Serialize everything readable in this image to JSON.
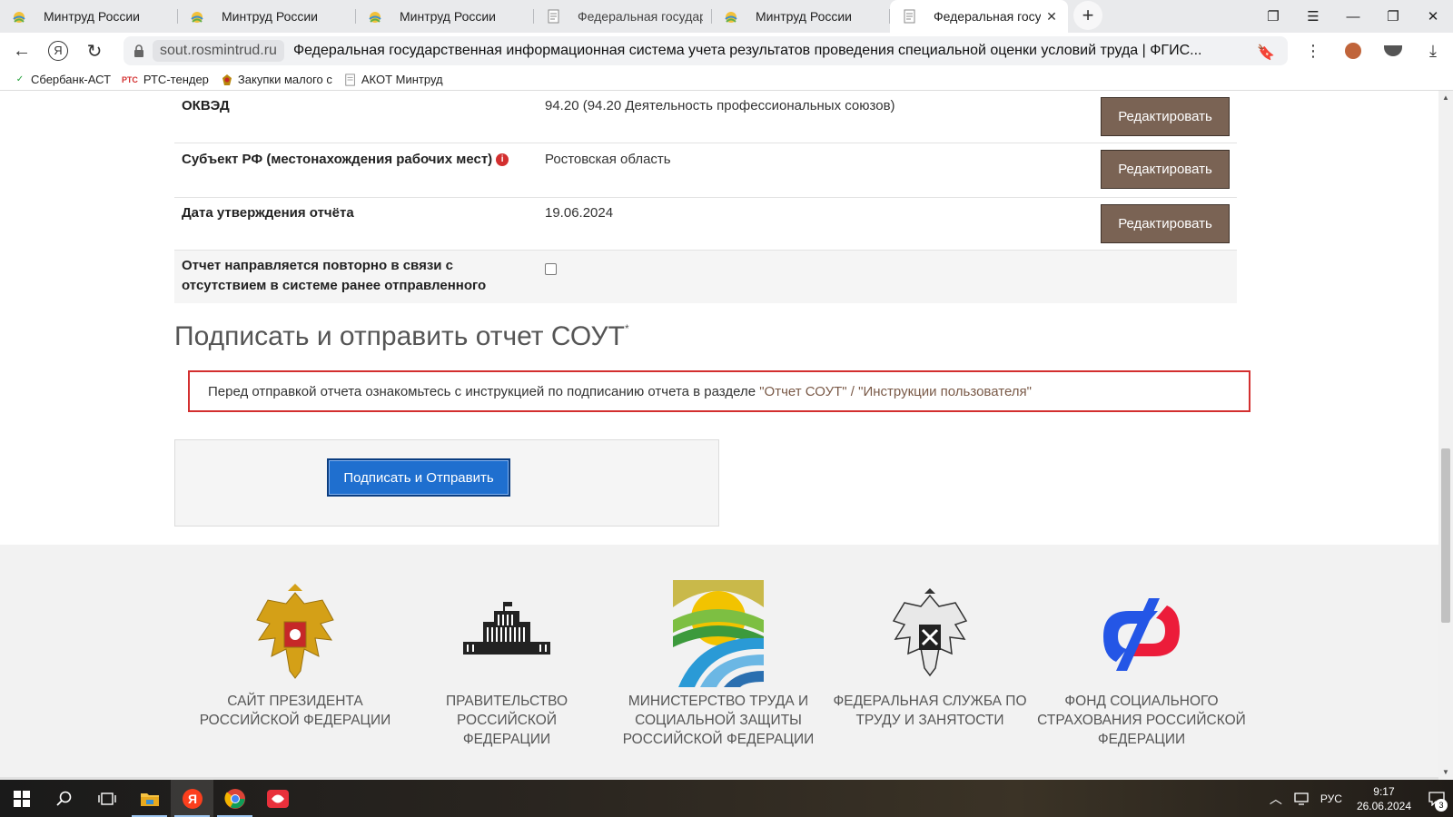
{
  "browser": {
    "tabs": [
      {
        "label": "Минтруд России",
        "favicon": "mintrud-favicon",
        "active": false
      },
      {
        "label": "Минтруд России",
        "favicon": "mintrud-favicon",
        "active": false
      },
      {
        "label": "Минтруд России",
        "favicon": "mintrud-favicon",
        "active": false
      },
      {
        "label": "Федеральная государстве",
        "favicon": "document-favicon",
        "active": false
      },
      {
        "label": "Минтруд России",
        "favicon": "mintrud-favicon",
        "active": false
      },
      {
        "label": "Федеральная государс",
        "favicon": "document-favicon",
        "active": true
      }
    ],
    "new_tab_symbol": "+",
    "address": {
      "domain": "sout.rosmintrud.ru",
      "title": "Федеральная государственная информационная система учета результатов проведения специальной оценки условий труда | ФГИС..."
    },
    "bookmarks": [
      {
        "label": "Сбербанк-АСТ",
        "icon": "sberbank-icon"
      },
      {
        "label": "РТС-тендер",
        "icon": "rts-icon",
        "prefix": "РТС"
      },
      {
        "label": "Закупки малого с",
        "icon": "emblem-icon"
      },
      {
        "label": "АКОТ Минтруд",
        "icon": "document-icon"
      }
    ]
  },
  "report": {
    "rows": [
      {
        "label": "ОКВЭД",
        "value": "94.20 (94.20 Деятельность профессиональных союзов)",
        "button": "Редактировать"
      },
      {
        "label": "Субъект РФ (местонахождения рабочих мест)",
        "value": "Ростовская область",
        "button": "Редактировать",
        "info": "i"
      },
      {
        "label": "Дата утверждения отчёта",
        "value": "19.06.2024",
        "button": "Редактировать"
      },
      {
        "label_line1": "Отчет направляется повторно в связи с",
        "label_line2": "отсутствием в системе ранее отправленного",
        "checked": false
      }
    ],
    "section_title": "Подписать и отправить отчет СОУТ",
    "section_title_mark": "*",
    "notice": {
      "text": "Перед отправкой отчета ознакомьтесь с инструкцией по подписанию отчета в разделе ",
      "link1": "\"Отчет СОУТ\"",
      "sep": " / ",
      "link2": "\"Инструкции пользователя\""
    },
    "sign_button": "Подписать и Отправить"
  },
  "footer": {
    "orgs": [
      {
        "name_l1": "САЙТ ПРЕЗИДЕНТА",
        "name_l2": "РОССИЙСКОЙ ФЕДЕРАЦИИ",
        "icon": "russian-coat-of-arms-icon"
      },
      {
        "name_l1": "ПРАВИТЕЛЬСТВО РОССИЙСКОЙ",
        "name_l2": "ФЕДЕРАЦИИ",
        "icon": "government-house-icon"
      },
      {
        "name_l1": "МИНИСТЕРСТВО ТРУДА И",
        "name_l2": "СОЦИАЛЬНОЙ ЗАЩИТЫ",
        "name_l3": "РОССИЙСКОЙ ФЕДЕРАЦИИ",
        "icon": "mintrud-logo-icon"
      },
      {
        "name_l1": "ФЕДЕРАЛЬНАЯ СЛУЖБА ПО",
        "name_l2": "ТРУДУ И ЗАНЯТОСТИ",
        "icon": "rostrud-emblem-icon"
      },
      {
        "name_l1": "ФОНД СОЦИАЛЬНОГО",
        "name_l2": "СТРАХОВАНИЯ РОССИЙСКОЙ",
        "name_l3": "ФЕДЕРАЦИИ",
        "icon": "sfr-logo-icon"
      }
    ]
  },
  "taskbar": {
    "language": "РУС",
    "time": "9:17",
    "date": "26.06.2024",
    "notifications": "3"
  },
  "colors": {
    "edit_button": "#7a6354",
    "sign_button": "#1f6fcf",
    "notice_border": "#d32f2f"
  }
}
